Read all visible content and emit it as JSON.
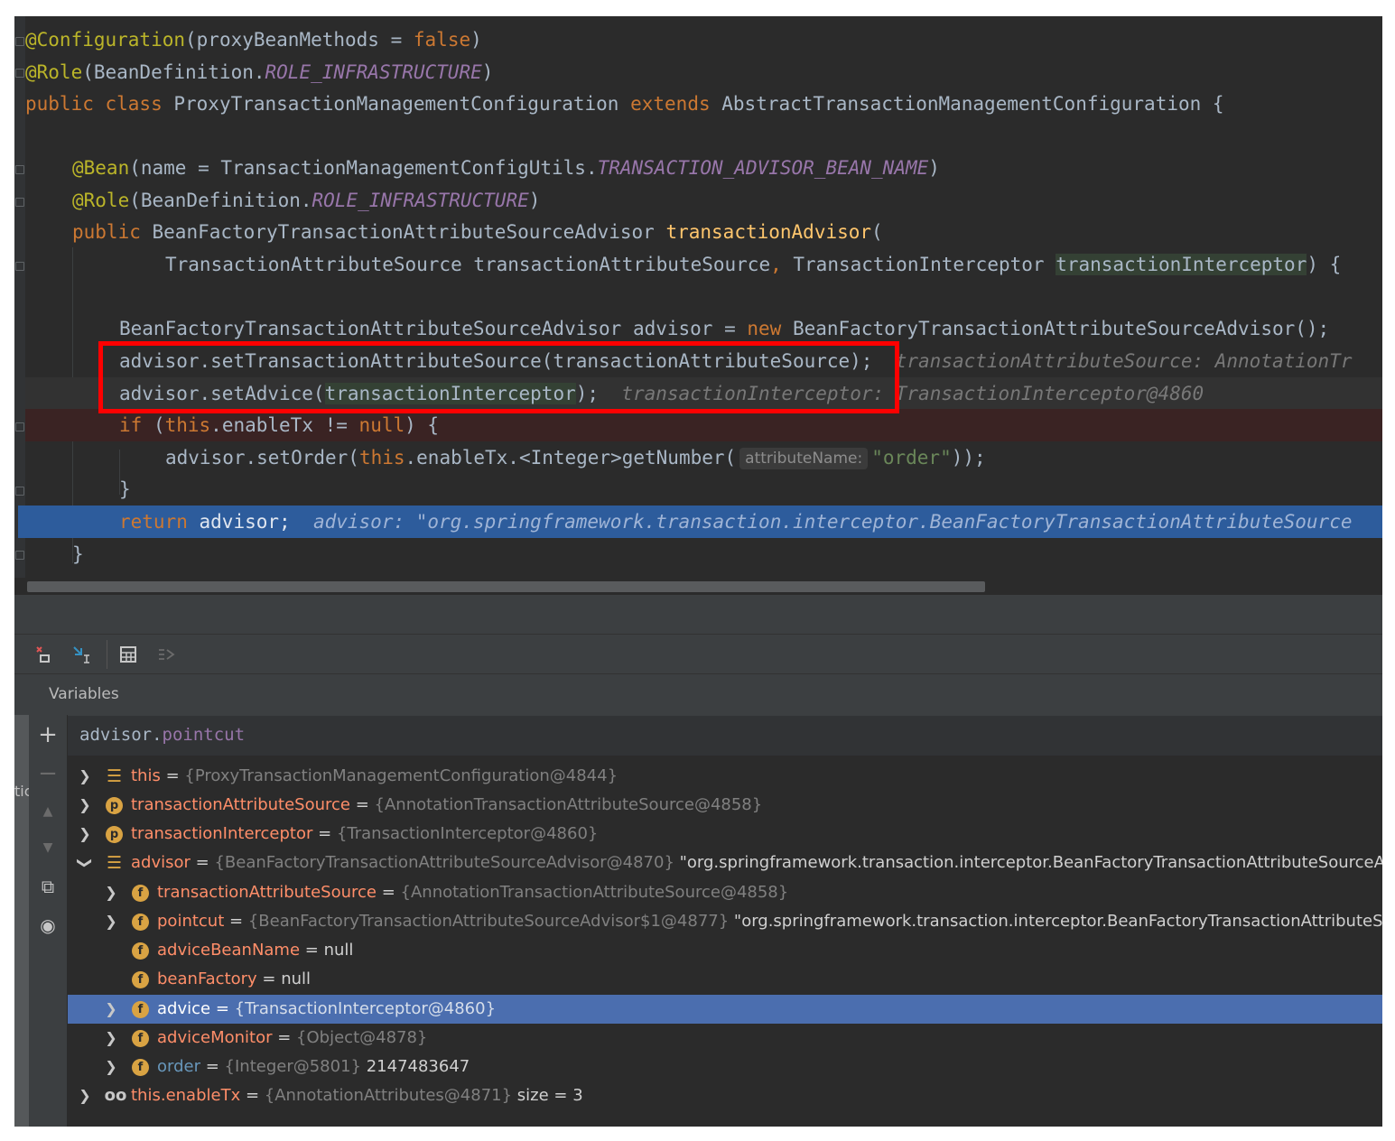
{
  "editor": {
    "line1": {
      "annot": "@Configuration",
      "open": "(proxyBeanMethods = ",
      "val": "false",
      "close": ")"
    },
    "line2": {
      "annot": "@Role",
      "open": "(BeanDefinition.",
      "const": "ROLE_INFRASTRUCTURE",
      "close": ")"
    },
    "line3": {
      "kw1": "public class ",
      "name": "ProxyTransactionManagementConfiguration ",
      "kw2": "extends ",
      "parent": "AbstractTransactionManagementConfiguration {"
    },
    "line5": {
      "annot": "@Bean",
      "open": "(name = TransactionManagementConfigUtils.",
      "const": "TRANSACTION_ADVISOR_BEAN_NAME",
      "close": ")"
    },
    "line6": {
      "annot": "@Role",
      "open": "(BeanDefinition.",
      "const": "ROLE_INFRASTRUCTURE",
      "close": ")"
    },
    "line7": {
      "kw": "public ",
      "type": "BeanFactoryTransactionAttributeSourceAdvisor ",
      "method": "transactionAdvisor",
      "open": "("
    },
    "line8": {
      "p1": "TransactionAttributeSource transactionAttributeSource",
      "comma": ", ",
      "p2type": "TransactionInterceptor ",
      "p2": "transactionInterceptor",
      "close": ") {"
    },
    "line10": {
      "decl": "BeanFactoryTransactionAttributeSourceAdvisor advisor = ",
      "kw": "new ",
      "ctor": "BeanFactoryTransactionAttributeSourceAdvisor();"
    },
    "line11": {
      "code": "advisor.setTransactionAttributeSource(transactionAttributeSource);",
      "inline": "transactionAttributeSource: AnnotationTr"
    },
    "line12": {
      "pre": "advisor.setAdvice(",
      "arg": "transactionInterceptor",
      "post": ");",
      "inline": "transactionInterceptor: TransactionInterceptor@4860"
    },
    "line13": {
      "kw": "if ",
      "p1": "(",
      "kw2": "this",
      "mid": ".enableTx != ",
      "kw3": "null",
      "end": ") {"
    },
    "line14": {
      "pre": "advisor.setOrder(",
      "kw": "this",
      "mid": ".enableTx.<Integer>getNumber(",
      "hint": "attributeName:",
      "str": "\"order\"",
      "end": "));"
    },
    "line15": {
      "text": "}"
    },
    "line16": {
      "kw": "return ",
      "var": "advisor;",
      "inline": "advisor: \"org.springframework.transaction.interceptor.BeanFactoryTransactionAttributeSource"
    },
    "line17": {
      "text": "}"
    }
  },
  "debugger": {
    "panel_title": "Variables",
    "watch_expression": {
      "obj": "advisor.",
      "field": "pointcut"
    },
    "left_strip_fragment": "tic",
    "variables": [
      {
        "name": "this",
        "eq": " = ",
        "value": "{ProxyTransactionManagementConfiguration@4844}",
        "extra": ""
      },
      {
        "name": "transactionAttributeSource",
        "eq": " = ",
        "value": "{AnnotationTransactionAttributeSource@4858}",
        "extra": ""
      },
      {
        "name": "transactionInterceptor",
        "eq": " = ",
        "value": "{TransactionInterceptor@4860}",
        "extra": ""
      },
      {
        "name": "advisor",
        "eq": " = ",
        "value": "{BeanFactoryTransactionAttributeSourceAdvisor@4870}",
        "extra": " \"org.springframework.transaction.interceptor.BeanFactoryTransactionAttributeSourceAdvisor: a"
      },
      {
        "name": "transactionAttributeSource",
        "eq": " = ",
        "value": "{AnnotationTransactionAttributeSource@4858}",
        "extra": ""
      },
      {
        "name": "pointcut",
        "eq": " = ",
        "value": "{BeanFactoryTransactionAttributeSourceAdvisor$1@4877}",
        "extra": " \"org.springframework.transaction.interceptor.BeanFactoryTransactionAttributeSourceAd"
      },
      {
        "name": "adviceBeanName",
        "eq": " = ",
        "value": "",
        "extra": "null"
      },
      {
        "name": "beanFactory",
        "eq": " = ",
        "value": "",
        "extra": "null"
      },
      {
        "name": "advice",
        "eq": " = ",
        "value": "{TransactionInterceptor@4860}",
        "extra": ""
      },
      {
        "name": "adviceMonitor",
        "eq": " = ",
        "value": "{Object@4878}",
        "extra": ""
      },
      {
        "name": "order",
        "eq": " = ",
        "value": "{Integer@5801}",
        "extra": " 2147483647"
      },
      {
        "name": "this.enableTx",
        "eq": " = ",
        "value": "{AnnotationAttributes@4871}",
        "extra": "  size = 3"
      }
    ],
    "icons": {
      "field": "f",
      "param": "p"
    }
  }
}
